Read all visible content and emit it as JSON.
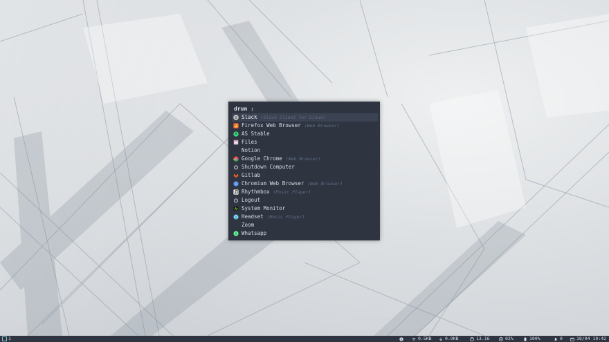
{
  "launcher": {
    "prompt": "drun :",
    "query": "",
    "entries": [
      {
        "name": "Slack",
        "desc": "(Slack Client for Linux)",
        "icon": "slack-icon",
        "color": "#e8e8e8",
        "selected": true
      },
      {
        "name": "Firefox Web Browser",
        "desc": "(Web Browser)",
        "icon": "firefox-icon",
        "color": "#ff7139"
      },
      {
        "name": "AS Stable",
        "desc": "",
        "icon": "android-studio-icon",
        "color": "#3ddc84"
      },
      {
        "name": "Files",
        "desc": "",
        "icon": "files-icon",
        "color": "#e8c8e0"
      },
      {
        "name": "Notion",
        "desc": "",
        "icon": "",
        "color": ""
      },
      {
        "name": "Google Chrome",
        "desc": "(Web Browser)",
        "icon": "chrome-icon",
        "color": "#34a853"
      },
      {
        "name": "Shutdown Computer",
        "desc": "",
        "icon": "power-icon",
        "color": "#d8dee9"
      },
      {
        "name": "Gitlab",
        "desc": "",
        "icon": "gitlab-icon",
        "color": "#fc6d26"
      },
      {
        "name": "Chromium Web Browser",
        "desc": "(Web Browser)",
        "icon": "chromium-icon",
        "color": "#4f8ee8"
      },
      {
        "name": "Rhythmbox",
        "desc": "(Music Player)",
        "icon": "rhythmbox-icon",
        "color": "#f0f0f0"
      },
      {
        "name": "Logout",
        "desc": "",
        "icon": "logout-icon",
        "color": "#d8dee9"
      },
      {
        "name": "System Monitor",
        "desc": "",
        "icon": "system-monitor-icon",
        "color": "#3c7a3c"
      },
      {
        "name": "Headset",
        "desc": "(Music Player)",
        "icon": "headset-icon",
        "color": "#4fb3d9"
      },
      {
        "name": "Zoom",
        "desc": "",
        "icon": "",
        "color": ""
      },
      {
        "name": "Whatsapp",
        "desc": "",
        "icon": "whatsapp-icon",
        "color": "#25d366"
      }
    ]
  },
  "statusbar": {
    "workspace": "1",
    "upload": "0.5KB",
    "download": "0.0KB",
    "cpu": "13.16",
    "memory": "02%",
    "battery": "100%",
    "volume": "0",
    "datetime": "18/04 10:42"
  }
}
